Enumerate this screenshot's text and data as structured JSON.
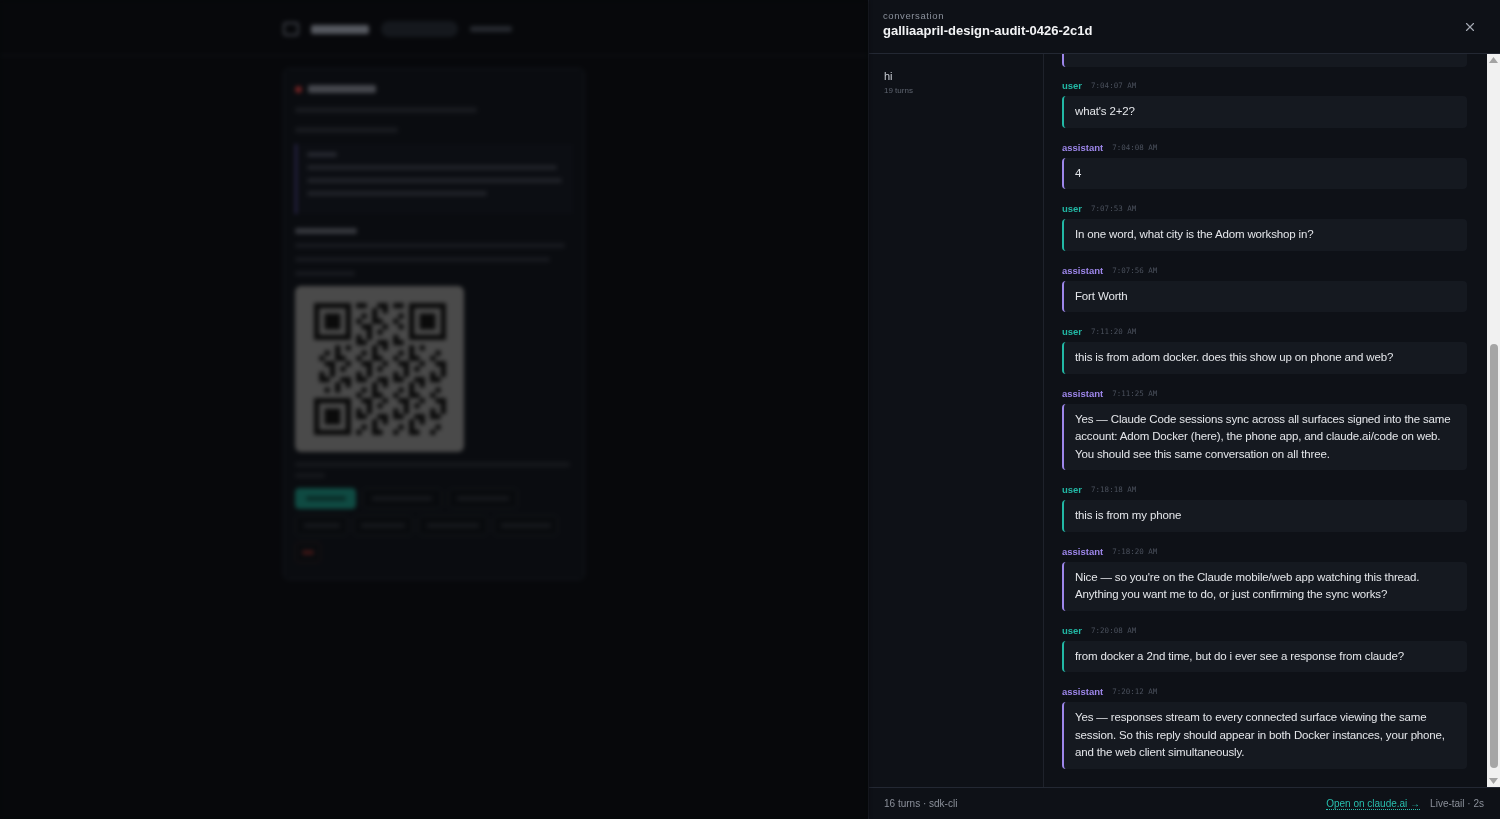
{
  "drawer": {
    "label": "conversation",
    "title": "galliaapril-design-audit-0426-2c1d"
  },
  "sidebar": {
    "items": [
      {
        "title": "hi",
        "turns": "19 turns"
      }
    ]
  },
  "clipped_message": {
    "color": "#9d86ea"
  },
  "messages": [
    {
      "role": "user",
      "color": "#22b8a5",
      "time": "7:04:07 AM",
      "text": "what's 2+2?"
    },
    {
      "role": "assistant",
      "color": "#9d86ea",
      "time": "7:04:08 AM",
      "text": "4"
    },
    {
      "role": "user",
      "color": "#22b8a5",
      "time": "7:07:53 AM",
      "text": "In one word, what city is the Adom workshop in?"
    },
    {
      "role": "assistant",
      "color": "#9d86ea",
      "time": "7:07:56 AM",
      "text": "Fort Worth"
    },
    {
      "role": "user",
      "color": "#22b8a5",
      "time": "7:11:20 AM",
      "text": "this is from adom docker. does this show up on phone and web?"
    },
    {
      "role": "assistant",
      "color": "#9d86ea",
      "time": "7:11:25 AM",
      "text": "Yes — Claude Code sessions sync across all surfaces signed into the same account: Adom Docker (here), the phone app, and claude.ai/code on web. You should see this same conversation on all three."
    },
    {
      "role": "user",
      "color": "#22b8a5",
      "time": "7:18:18 AM",
      "text": "this is from my phone"
    },
    {
      "role": "assistant",
      "color": "#9d86ea",
      "time": "7:18:20 AM",
      "text": "Nice — so you're on the Claude mobile/web app watching this thread. Anything you want me to do, or just confirming the sync works?"
    },
    {
      "role": "user",
      "color": "#22b8a5",
      "time": "7:20:08 AM",
      "text": "from docker a 2nd time, but do i ever see a response from claude?"
    },
    {
      "role": "assistant",
      "color": "#9d86ea",
      "time": "7:20:12 AM",
      "text": "Yes — responses stream to every connected surface viewing the same session. So this reply should appear in both Docker instances, your phone, and the web client simultaneously."
    }
  ],
  "footer": {
    "summary": "16 turns · sdk-cli",
    "link": "Open on claude.ai →",
    "status": "Live-tail · 2s"
  }
}
